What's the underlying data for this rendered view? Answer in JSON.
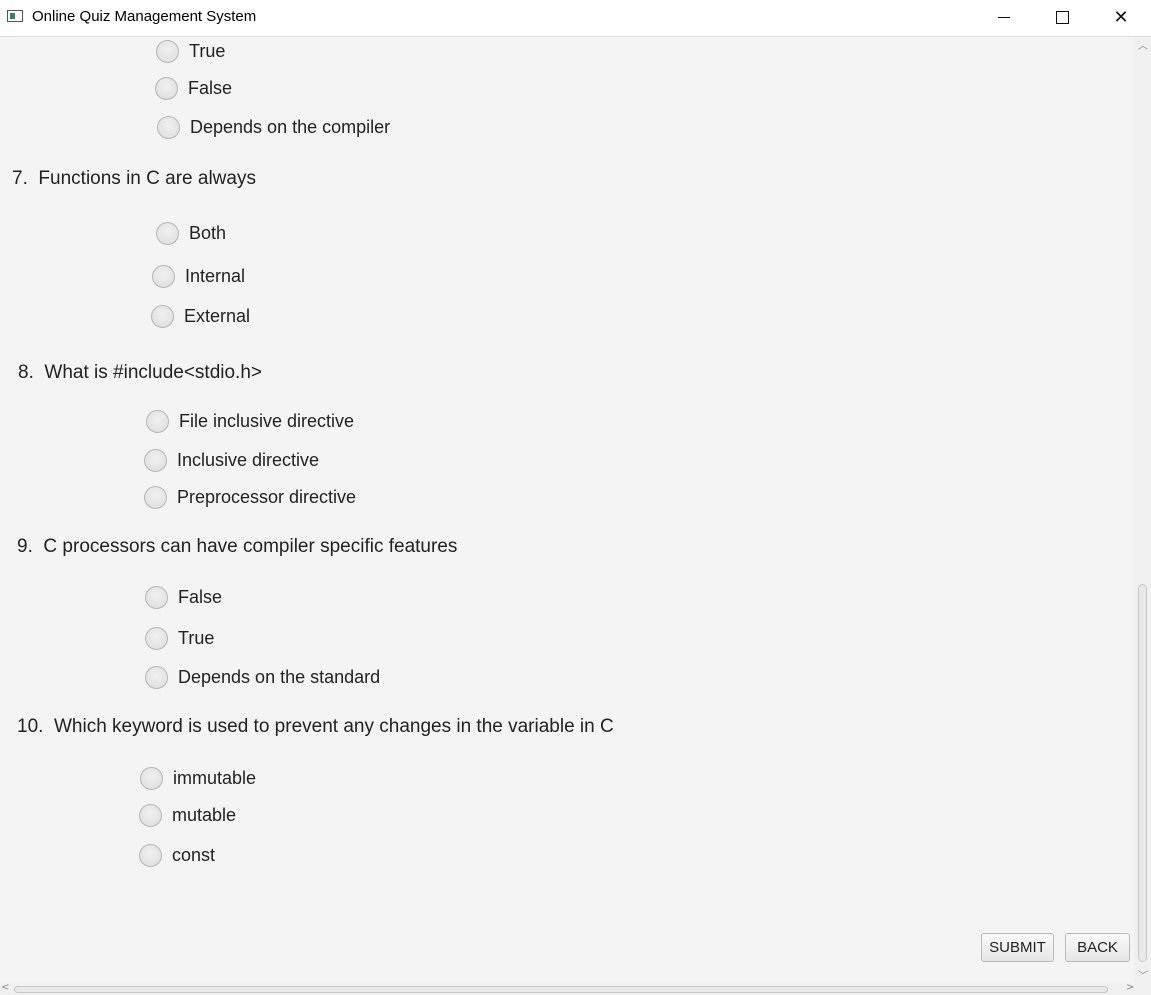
{
  "window": {
    "title": "Online Quiz Management System",
    "controls": {
      "minimize": "minimize-icon",
      "maximize": "maximize-icon",
      "close": "close-icon"
    }
  },
  "quiz": {
    "q6": {
      "options": [
        "True",
        "False",
        "Depends on the compiler"
      ]
    },
    "q7": {
      "number": "7.",
      "text": "Functions in C are always",
      "options": [
        "Both",
        "Internal",
        "External"
      ]
    },
    "q8": {
      "number": "8.",
      "text": "What is #include<stdio.h>",
      "options": [
        "File inclusive directive",
        "Inclusive directive",
        "Preprocessor directive"
      ]
    },
    "q9": {
      "number": "9.",
      "text": "C processors can have compiler specific features",
      "options": [
        "False",
        "True",
        "Depends on the standard"
      ]
    },
    "q10": {
      "number": "10.",
      "text": "Which keyword is used to prevent any changes in the variable in C",
      "options": [
        "immutable",
        "mutable",
        "const"
      ]
    }
  },
  "buttons": {
    "submit": "SUBMIT",
    "back": "BACK"
  }
}
